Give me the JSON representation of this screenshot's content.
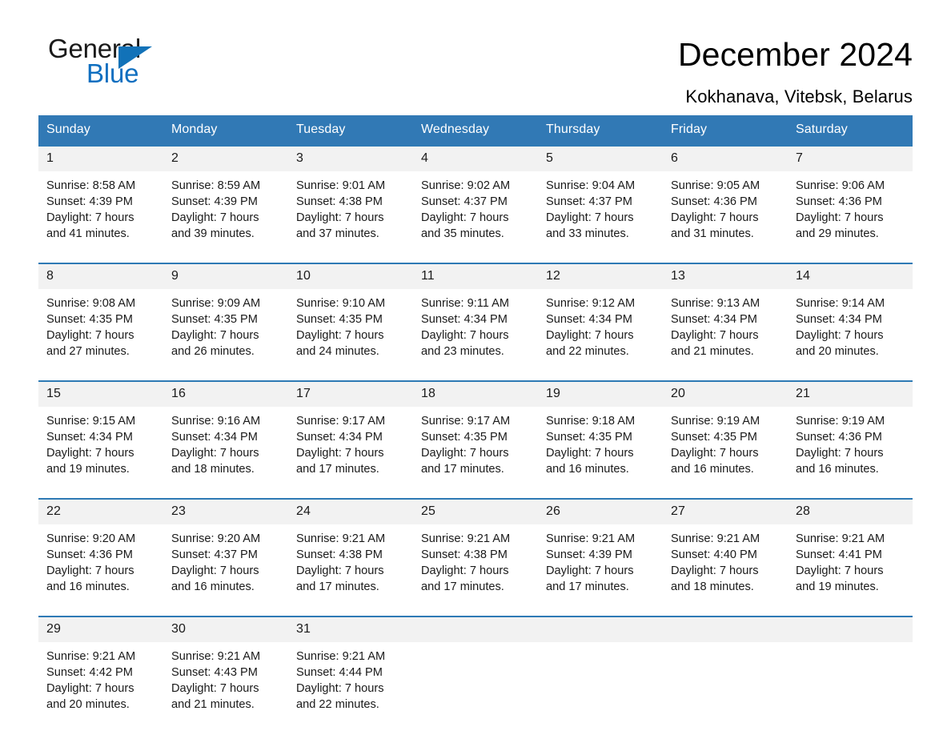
{
  "brand": {
    "name_part1": "General",
    "name_part2": "Blue",
    "triangle_color": "#1272b8",
    "blue_color": "#0f6fc0"
  },
  "header": {
    "title": "December 2024",
    "subtitle": "Kokhanava, Vitebsk, Belarus"
  },
  "calendar": {
    "accent_color": "#3179b5",
    "daynum_bg": "#f2f2f2",
    "weekday_headers": [
      "Sunday",
      "Monday",
      "Tuesday",
      "Wednesday",
      "Thursday",
      "Friday",
      "Saturday"
    ],
    "weeks": [
      {
        "daynums": [
          "1",
          "2",
          "3",
          "4",
          "5",
          "6",
          "7"
        ],
        "cells": [
          {
            "sunrise": "Sunrise: 8:58 AM",
            "sunset": "Sunset: 4:39 PM",
            "daylight1": "Daylight: 7 hours",
            "daylight2": "and 41 minutes."
          },
          {
            "sunrise": "Sunrise: 8:59 AM",
            "sunset": "Sunset: 4:39 PM",
            "daylight1": "Daylight: 7 hours",
            "daylight2": "and 39 minutes."
          },
          {
            "sunrise": "Sunrise: 9:01 AM",
            "sunset": "Sunset: 4:38 PM",
            "daylight1": "Daylight: 7 hours",
            "daylight2": "and 37 minutes."
          },
          {
            "sunrise": "Sunrise: 9:02 AM",
            "sunset": "Sunset: 4:37 PM",
            "daylight1": "Daylight: 7 hours",
            "daylight2": "and 35 minutes."
          },
          {
            "sunrise": "Sunrise: 9:04 AM",
            "sunset": "Sunset: 4:37 PM",
            "daylight1": "Daylight: 7 hours",
            "daylight2": "and 33 minutes."
          },
          {
            "sunrise": "Sunrise: 9:05 AM",
            "sunset": "Sunset: 4:36 PM",
            "daylight1": "Daylight: 7 hours",
            "daylight2": "and 31 minutes."
          },
          {
            "sunrise": "Sunrise: 9:06 AM",
            "sunset": "Sunset: 4:36 PM",
            "daylight1": "Daylight: 7 hours",
            "daylight2": "and 29 minutes."
          }
        ]
      },
      {
        "daynums": [
          "8",
          "9",
          "10",
          "11",
          "12",
          "13",
          "14"
        ],
        "cells": [
          {
            "sunrise": "Sunrise: 9:08 AM",
            "sunset": "Sunset: 4:35 PM",
            "daylight1": "Daylight: 7 hours",
            "daylight2": "and 27 minutes."
          },
          {
            "sunrise": "Sunrise: 9:09 AM",
            "sunset": "Sunset: 4:35 PM",
            "daylight1": "Daylight: 7 hours",
            "daylight2": "and 26 minutes."
          },
          {
            "sunrise": "Sunrise: 9:10 AM",
            "sunset": "Sunset: 4:35 PM",
            "daylight1": "Daylight: 7 hours",
            "daylight2": "and 24 minutes."
          },
          {
            "sunrise": "Sunrise: 9:11 AM",
            "sunset": "Sunset: 4:34 PM",
            "daylight1": "Daylight: 7 hours",
            "daylight2": "and 23 minutes."
          },
          {
            "sunrise": "Sunrise: 9:12 AM",
            "sunset": "Sunset: 4:34 PM",
            "daylight1": "Daylight: 7 hours",
            "daylight2": "and 22 minutes."
          },
          {
            "sunrise": "Sunrise: 9:13 AM",
            "sunset": "Sunset: 4:34 PM",
            "daylight1": "Daylight: 7 hours",
            "daylight2": "and 21 minutes."
          },
          {
            "sunrise": "Sunrise: 9:14 AM",
            "sunset": "Sunset: 4:34 PM",
            "daylight1": "Daylight: 7 hours",
            "daylight2": "and 20 minutes."
          }
        ]
      },
      {
        "daynums": [
          "15",
          "16",
          "17",
          "18",
          "19",
          "20",
          "21"
        ],
        "cells": [
          {
            "sunrise": "Sunrise: 9:15 AM",
            "sunset": "Sunset: 4:34 PM",
            "daylight1": "Daylight: 7 hours",
            "daylight2": "and 19 minutes."
          },
          {
            "sunrise": "Sunrise: 9:16 AM",
            "sunset": "Sunset: 4:34 PM",
            "daylight1": "Daylight: 7 hours",
            "daylight2": "and 18 minutes."
          },
          {
            "sunrise": "Sunrise: 9:17 AM",
            "sunset": "Sunset: 4:34 PM",
            "daylight1": "Daylight: 7 hours",
            "daylight2": "and 17 minutes."
          },
          {
            "sunrise": "Sunrise: 9:17 AM",
            "sunset": "Sunset: 4:35 PM",
            "daylight1": "Daylight: 7 hours",
            "daylight2": "and 17 minutes."
          },
          {
            "sunrise": "Sunrise: 9:18 AM",
            "sunset": "Sunset: 4:35 PM",
            "daylight1": "Daylight: 7 hours",
            "daylight2": "and 16 minutes."
          },
          {
            "sunrise": "Sunrise: 9:19 AM",
            "sunset": "Sunset: 4:35 PM",
            "daylight1": "Daylight: 7 hours",
            "daylight2": "and 16 minutes."
          },
          {
            "sunrise": "Sunrise: 9:19 AM",
            "sunset": "Sunset: 4:36 PM",
            "daylight1": "Daylight: 7 hours",
            "daylight2": "and 16 minutes."
          }
        ]
      },
      {
        "daynums": [
          "22",
          "23",
          "24",
          "25",
          "26",
          "27",
          "28"
        ],
        "cells": [
          {
            "sunrise": "Sunrise: 9:20 AM",
            "sunset": "Sunset: 4:36 PM",
            "daylight1": "Daylight: 7 hours",
            "daylight2": "and 16 minutes."
          },
          {
            "sunrise": "Sunrise: 9:20 AM",
            "sunset": "Sunset: 4:37 PM",
            "daylight1": "Daylight: 7 hours",
            "daylight2": "and 16 minutes."
          },
          {
            "sunrise": "Sunrise: 9:21 AM",
            "sunset": "Sunset: 4:38 PM",
            "daylight1": "Daylight: 7 hours",
            "daylight2": "and 17 minutes."
          },
          {
            "sunrise": "Sunrise: 9:21 AM",
            "sunset": "Sunset: 4:38 PM",
            "daylight1": "Daylight: 7 hours",
            "daylight2": "and 17 minutes."
          },
          {
            "sunrise": "Sunrise: 9:21 AM",
            "sunset": "Sunset: 4:39 PM",
            "daylight1": "Daylight: 7 hours",
            "daylight2": "and 17 minutes."
          },
          {
            "sunrise": "Sunrise: 9:21 AM",
            "sunset": "Sunset: 4:40 PM",
            "daylight1": "Daylight: 7 hours",
            "daylight2": "and 18 minutes."
          },
          {
            "sunrise": "Sunrise: 9:21 AM",
            "sunset": "Sunset: 4:41 PM",
            "daylight1": "Daylight: 7 hours",
            "daylight2": "and 19 minutes."
          }
        ]
      },
      {
        "daynums": [
          "29",
          "30",
          "31",
          "",
          "",
          "",
          ""
        ],
        "cells": [
          {
            "sunrise": "Sunrise: 9:21 AM",
            "sunset": "Sunset: 4:42 PM",
            "daylight1": "Daylight: 7 hours",
            "daylight2": "and 20 minutes."
          },
          {
            "sunrise": "Sunrise: 9:21 AM",
            "sunset": "Sunset: 4:43 PM",
            "daylight1": "Daylight: 7 hours",
            "daylight2": "and 21 minutes."
          },
          {
            "sunrise": "Sunrise: 9:21 AM",
            "sunset": "Sunset: 4:44 PM",
            "daylight1": "Daylight: 7 hours",
            "daylight2": "and 22 minutes."
          },
          {
            "sunrise": "",
            "sunset": "",
            "daylight1": "",
            "daylight2": ""
          },
          {
            "sunrise": "",
            "sunset": "",
            "daylight1": "",
            "daylight2": ""
          },
          {
            "sunrise": "",
            "sunset": "",
            "daylight1": "",
            "daylight2": ""
          },
          {
            "sunrise": "",
            "sunset": "",
            "daylight1": "",
            "daylight2": ""
          }
        ]
      }
    ]
  }
}
